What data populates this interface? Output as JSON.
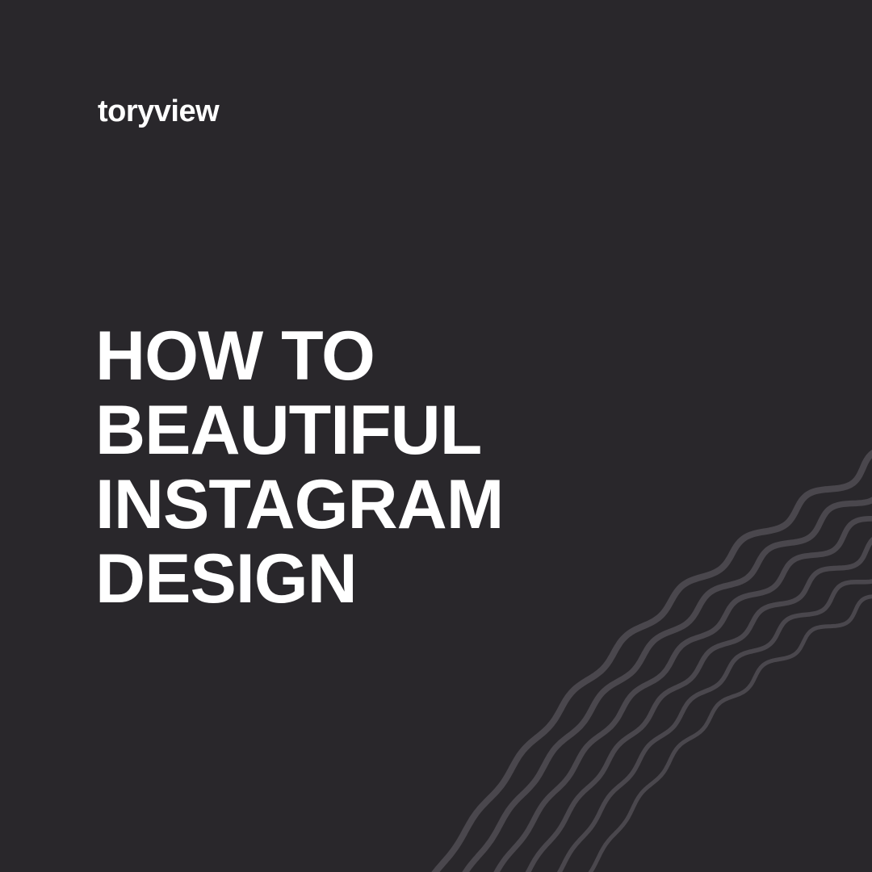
{
  "brand": {
    "name": "toryview"
  },
  "headline": {
    "lines": [
      "HOW TO",
      "BEAUTIFUL",
      "INSTAGRAM",
      "DESIGN"
    ]
  },
  "decoration": {
    "icon": "wavy-lines-graphic",
    "color": "#4a474d"
  },
  "colors": {
    "background": "#29272b",
    "text": "#ffffff"
  }
}
